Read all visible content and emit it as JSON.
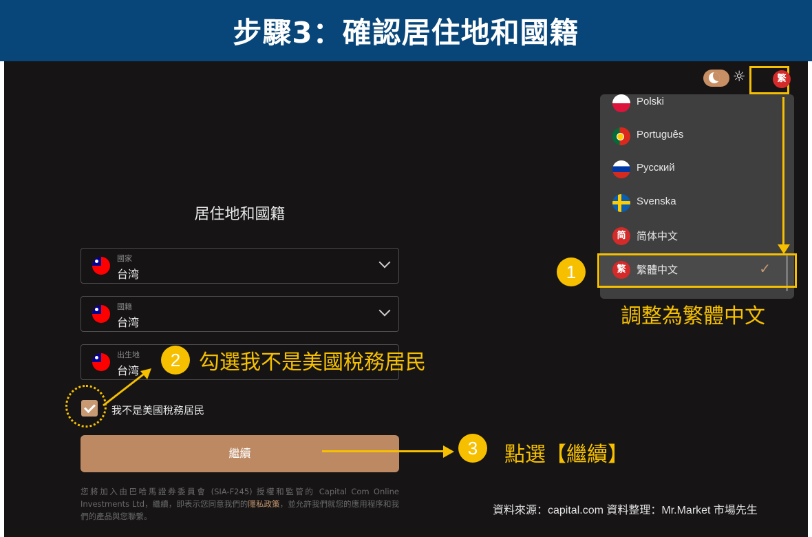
{
  "banner": {
    "title": "步驟3：確認居住地和國籍"
  },
  "header": {
    "current_language_badge": "繁",
    "theme_toggle_icon": "moon-icon",
    "theme_sun_icon": "sun-icon"
  },
  "language_menu": {
    "items": [
      {
        "label": "Polski",
        "flag": "pl"
      },
      {
        "label": "Português",
        "flag": "pt"
      },
      {
        "label": "Русский",
        "flag": "ru"
      },
      {
        "label": "Svenska",
        "flag": "se"
      },
      {
        "label": "简体中文",
        "flag": "zh",
        "badge": "简"
      },
      {
        "label": "繁體中文",
        "flag": "zh",
        "badge": "繁",
        "selected": true
      }
    ]
  },
  "form": {
    "title": "居住地和國籍",
    "fields": [
      {
        "label": "國家",
        "value": "台湾"
      },
      {
        "label": "國籍",
        "value": "台湾"
      },
      {
        "label": "出生地",
        "value": "台湾"
      }
    ],
    "checkbox_label": "我不是美國稅務居民",
    "checkbox_checked": true,
    "continue_label": "繼續",
    "disclaimer_before": "您將加入由巴哈馬證券委員會 (SIA-F245) 授權和監管的 Capital Com Online Investments Ltd，繼續，即表示您同意我們的",
    "disclaimer_link": "隱私政策",
    "disclaimer_after": "，並允許我們就您的應用程序和我們的產品與您聯繫。"
  },
  "annotations": {
    "step1_number": "1",
    "step1_text": "調整為繁體中文",
    "step2_number": "2",
    "step2_text": "勾選我不是美國稅務居民",
    "step3_number": "3",
    "step3_text": "點選【繼續】",
    "source": "資料來源：capital.com  資料整理：Mr.Market 市場先生"
  },
  "colors": {
    "banner": "#08467a",
    "accent": "#c89a74",
    "highlight": "#f6c000",
    "background": "#161414"
  }
}
